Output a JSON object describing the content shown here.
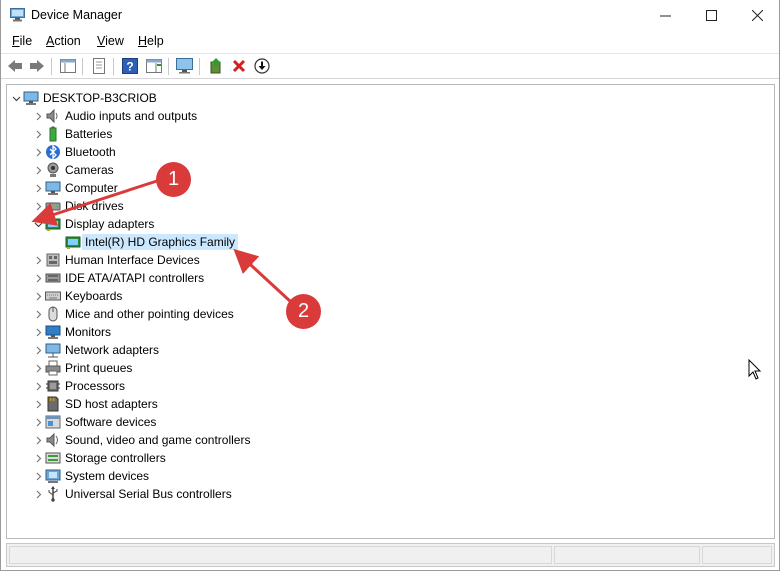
{
  "window": {
    "title": "Device Manager"
  },
  "menu": [
    {
      "label": "File",
      "accel": "F",
      "rest": "ile"
    },
    {
      "label": "Action",
      "accel": "A",
      "rest": "ction"
    },
    {
      "label": "View",
      "accel": "V",
      "rest": "iew"
    },
    {
      "label": "Help",
      "accel": "H",
      "rest": "elp"
    }
  ],
  "tree": {
    "root": "DESKTOP-B3CRIOB",
    "categories": [
      {
        "label": "Audio inputs and outputs",
        "icon": "speaker-icon"
      },
      {
        "label": "Batteries",
        "icon": "battery-icon"
      },
      {
        "label": "Bluetooth",
        "icon": "bluetooth-icon"
      },
      {
        "label": "Cameras",
        "icon": "camera-icon"
      },
      {
        "label": "Computer",
        "icon": "computer-icon"
      },
      {
        "label": "Disk drives",
        "icon": "disk-icon"
      },
      {
        "label": "Display adapters",
        "icon": "display-adapter-icon",
        "expanded": true,
        "children": [
          {
            "label": "Intel(R) HD Graphics Family",
            "icon": "display-adapter-icon",
            "selected": true
          }
        ]
      },
      {
        "label": "Human Interface Devices",
        "icon": "hid-icon"
      },
      {
        "label": "IDE ATA/ATAPI controllers",
        "icon": "ide-icon"
      },
      {
        "label": "Keyboards",
        "icon": "keyboard-icon"
      },
      {
        "label": "Mice and other pointing devices",
        "icon": "mouse-icon"
      },
      {
        "label": "Monitors",
        "icon": "monitor-icon"
      },
      {
        "label": "Network adapters",
        "icon": "network-icon"
      },
      {
        "label": "Print queues",
        "icon": "printer-icon"
      },
      {
        "label": "Processors",
        "icon": "processor-icon"
      },
      {
        "label": "SD host adapters",
        "icon": "sd-card-icon"
      },
      {
        "label": "Software devices",
        "icon": "software-icon"
      },
      {
        "label": "Sound, video and game controllers",
        "icon": "sound-icon"
      },
      {
        "label": "Storage controllers",
        "icon": "storage-icon"
      },
      {
        "label": "System devices",
        "icon": "system-icon"
      },
      {
        "label": "Universal Serial Bus controllers",
        "icon": "usb-icon"
      }
    ]
  },
  "annotations": [
    {
      "number": "1",
      "color": "#d93a3a"
    },
    {
      "number": "2",
      "color": "#d93a3a"
    }
  ]
}
